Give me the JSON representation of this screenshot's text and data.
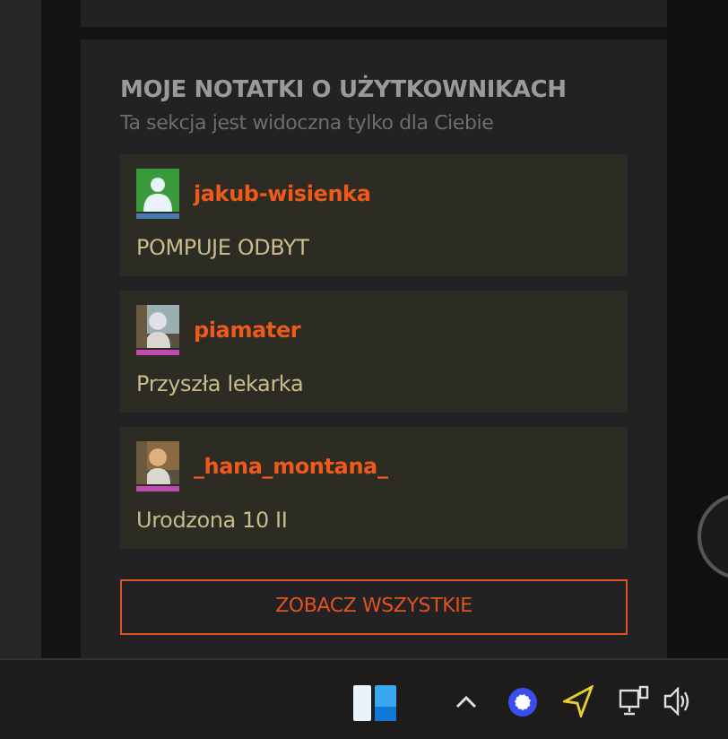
{
  "notes_section": {
    "title": "MOJE NOTATKI O UŻYTKOWNIKACH",
    "subtitle": "Ta sekcja jest widoczna tylko dla Ciebie",
    "notes": [
      {
        "username": "jakub-wisienka",
        "text": "POMPUJE ODBYT",
        "kind": "default",
        "color": "#4a7ab0"
      },
      {
        "username": "piamater",
        "text": "Przyszła lekarka",
        "kind": "picture",
        "color": "#c04ab0"
      },
      {
        "username": "_hana_montana_",
        "text": "Urodzona 10 II",
        "kind": "picture",
        "color": "#c04ab0"
      }
    ],
    "button": "ZOBACZ WSZYSTKIE"
  }
}
